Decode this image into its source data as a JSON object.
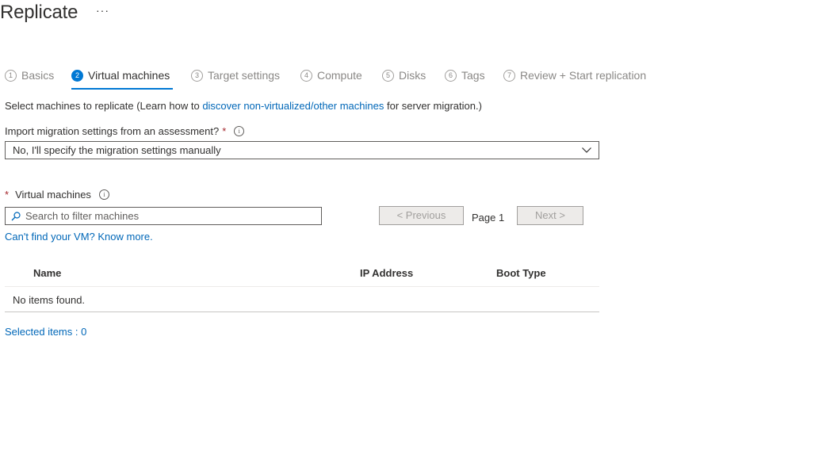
{
  "page": {
    "title": "Replicate",
    "more": "···"
  },
  "steps": [
    {
      "num": "1",
      "label": "Basics",
      "active": false
    },
    {
      "num": "2",
      "label": "Virtual machines",
      "active": true
    },
    {
      "num": "3",
      "label": "Target settings",
      "active": false
    },
    {
      "num": "4",
      "label": "Compute",
      "active": false
    },
    {
      "num": "5",
      "label": "Disks",
      "active": false
    },
    {
      "num": "6",
      "label": "Tags",
      "active": false
    },
    {
      "num": "7",
      "label": "Review + Start replication",
      "active": false
    }
  ],
  "intro": {
    "prefix": "Select machines to replicate (Learn how to ",
    "link": "discover non-virtualized/other machines",
    "suffix": " for server migration.)"
  },
  "import": {
    "label": "Import migration settings from an assessment?",
    "required": "*",
    "info": "i",
    "selected": "No, I'll specify the migration settings manually"
  },
  "vms": {
    "required": "*",
    "label": "Virtual machines",
    "info": "i",
    "search_placeholder": "Search to filter machines",
    "prev": "< Previous",
    "page": "Page 1",
    "next": "Next >",
    "cant_find": "Can't find your VM? Know more."
  },
  "table": {
    "columns": [
      "Name",
      "IP Address",
      "Boot Type"
    ],
    "empty": "No items found."
  },
  "selected": "Selected items : 0",
  "colors": {
    "accent": "#0078d4",
    "link": "#0067b8",
    "required": "#a4262c"
  }
}
